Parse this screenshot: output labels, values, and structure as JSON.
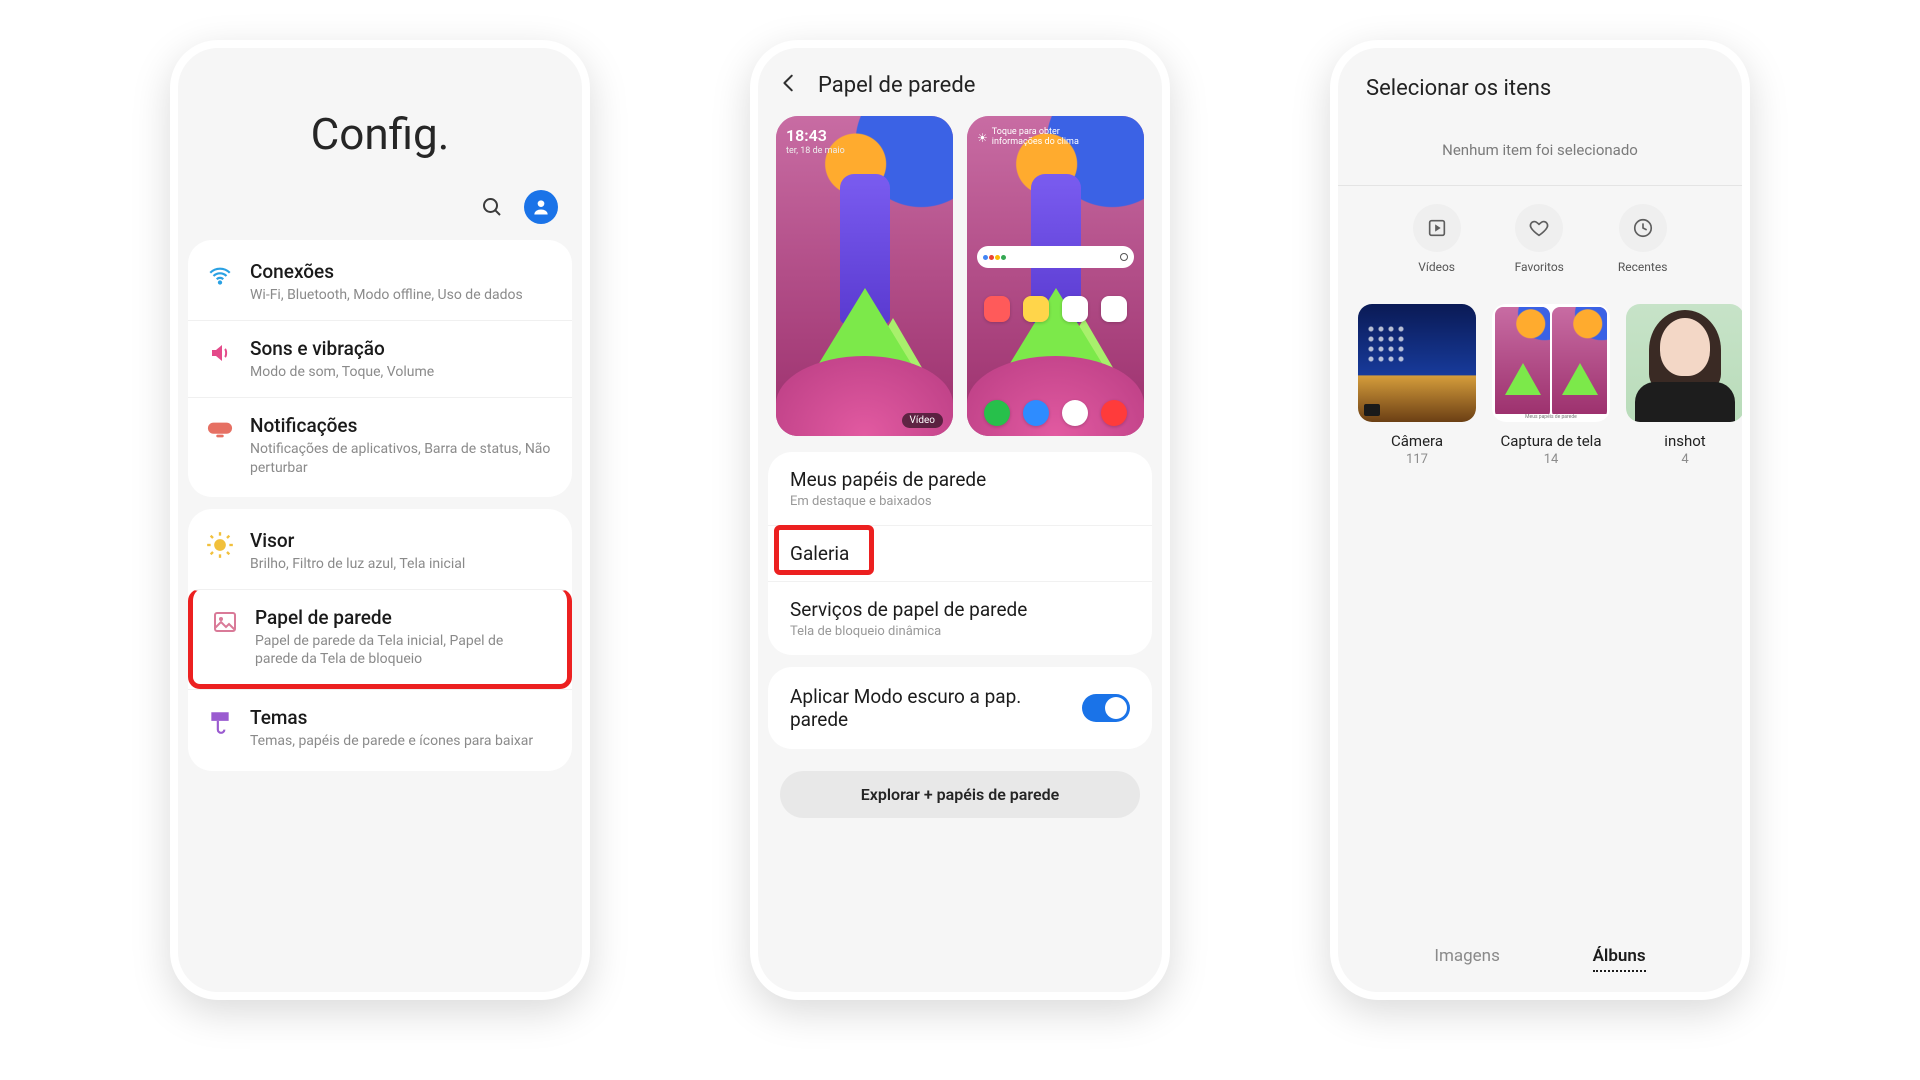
{
  "phone1": {
    "hero_title": "Config.",
    "items": [
      {
        "title": "Conexões",
        "sub": "Wi-Fi, Bluetooth, Modo offline, Uso de dados"
      },
      {
        "title": "Sons e vibração",
        "sub": "Modo de som, Toque, Volume"
      },
      {
        "title": "Notificações",
        "sub": "Notificações de aplicativos, Barra de status, Não perturbar"
      },
      {
        "title": "Visor",
        "sub": "Brilho, Filtro de luz azul, Tela inicial"
      },
      {
        "title": "Papel de parede",
        "sub": "Papel de parede da Tela inicial, Papel de parede da Tela de bloqueio"
      },
      {
        "title": "Temas",
        "sub": "Temas, papéis de parede e ícones para baixar"
      }
    ]
  },
  "phone2": {
    "header": "Papel de parede",
    "lock_time": "18:43",
    "lock_date": "ter, 18 de maio",
    "video_badge": "Vídeo",
    "home_weather": "Toque para obter informações do clima",
    "sections": {
      "my_wallpapers": {
        "title": "Meus papéis de parede",
        "sub": "Em destaque e baixados"
      },
      "gallery": {
        "title": "Galeria"
      },
      "services": {
        "title": "Serviços de papel de parede",
        "sub": "Tela de bloqueio dinâmica"
      }
    },
    "dark_mode_toggle": "Aplicar Modo escuro a pap. parede",
    "dark_mode_on": true,
    "explore_button": "Explorar + papéis de parede"
  },
  "phone3": {
    "title": "Selecionar os itens",
    "empty_state": "Nenhum item foi selecionado",
    "filters": [
      {
        "label": "Vídeos"
      },
      {
        "label": "Favoritos"
      },
      {
        "label": "Recentes"
      }
    ],
    "albums": [
      {
        "name": "Câmera",
        "count": "117"
      },
      {
        "name": "Captura de tela",
        "count": "14"
      },
      {
        "name": "inshot",
        "count": "4"
      }
    ],
    "tabs": {
      "images": "Imagens",
      "albums": "Álbuns"
    }
  }
}
